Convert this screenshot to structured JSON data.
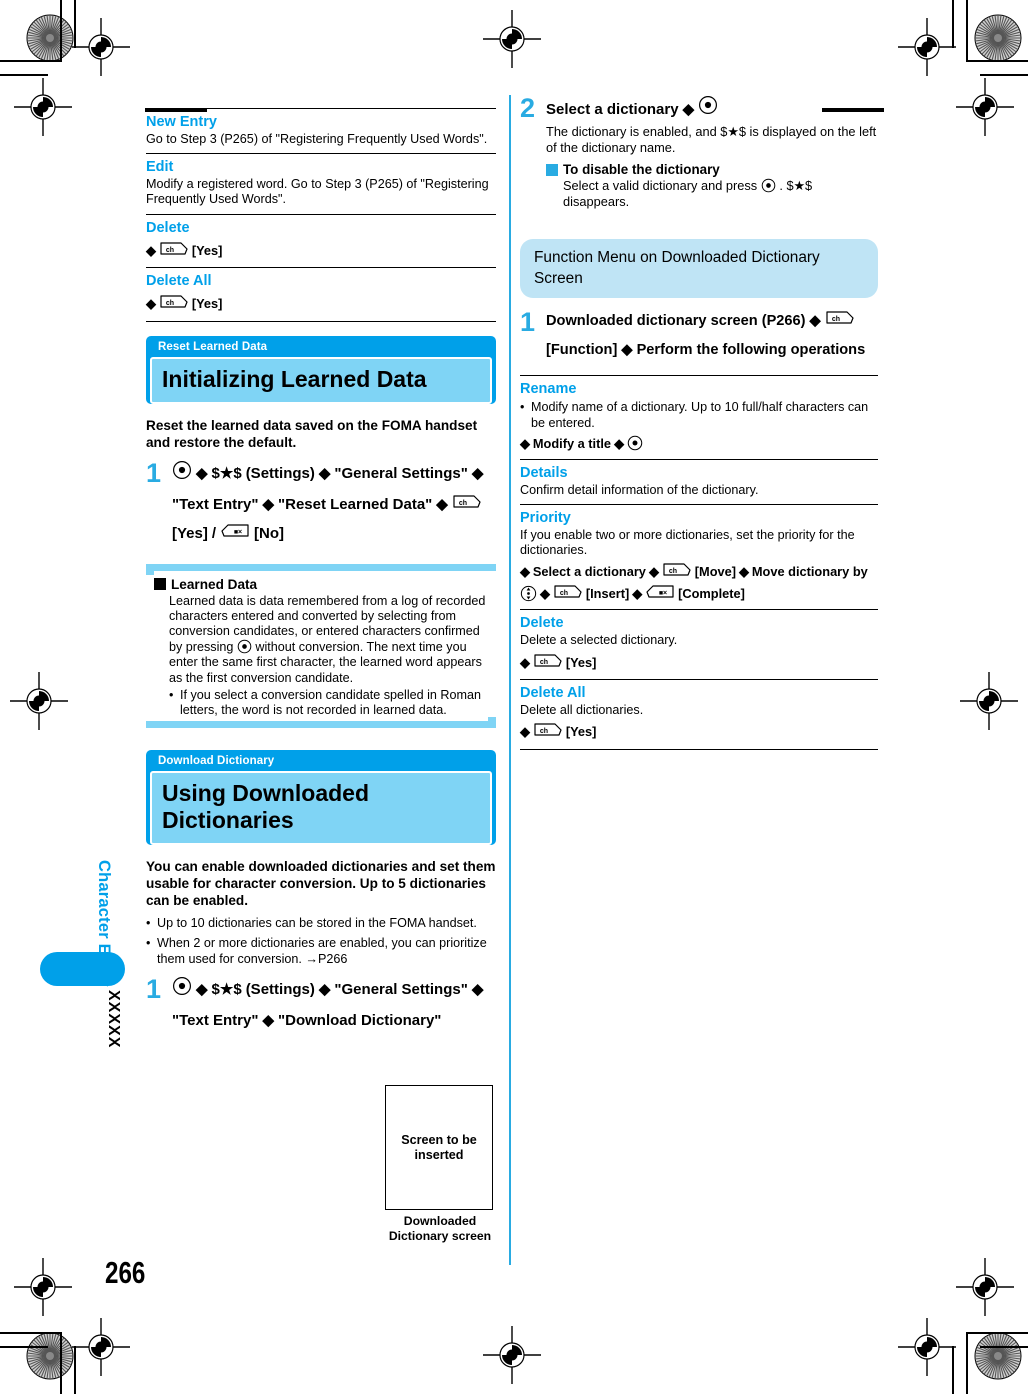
{
  "page": {
    "number": "266",
    "margin_label": "Character Entry",
    "margin_code": "XXXXX"
  },
  "icons": {
    "enter_key": "center-select-key-icon",
    "ch_key": "ch-function-key-icon",
    "clear_key": "clear-key-icon",
    "dpad_key": "dpad-updown-key-icon"
  },
  "left_column": {
    "entries": [
      {
        "title": "New Entry",
        "desc": "Go to Step 3 (P265) of \"Registering Frequently Used Words\"."
      },
      {
        "title": "Edit",
        "desc": "Modify a registered word. Go to Step 3 (P265) of \"Registering Frequently Used Words\"."
      },
      {
        "title": "Delete",
        "op_label": "[Yes]"
      },
      {
        "title": "Delete All",
        "op_label": "[Yes]"
      }
    ],
    "section_reset": {
      "kicker": "Reset Learned Data",
      "title": "Initializing Learned Data",
      "intro": "Reset the learned data saved on the FOMA handset and restore the default.",
      "step": {
        "number": "1",
        "p1": "(Settings)",
        "p2": "\"General Settings\"",
        "p3": "\"Text Entry\"",
        "p4": "\"Reset Learned Data\"",
        "yes": "[Yes]",
        "slash": "/",
        "no": "[No]",
        "star": "$★$"
      }
    },
    "note_learned": {
      "title": "Learned Data",
      "body_a": "Learned data is data remembered from a log of recorded characters entered and converted by selecting from conversion candidates, or entered characters confirmed by pressing",
      "body_b": "without conversion. The next time you enter the same first character, the learned word appears as the first conversion candidate.",
      "bullet": "If you select a conversion candidate spelled in Roman letters, the word is not recorded in learned data."
    },
    "section_download": {
      "kicker": "Download Dictionary",
      "title": "Using Downloaded Dictionaries",
      "intro": "You can enable downloaded dictionaries and set them usable for character conversion. Up to 5 dictionaries can be enabled.",
      "bullets": [
        "Up to 10 dictionaries can be stored in the FOMA handset.",
        "When 2 or more dictionaries are enabled, you can prioritize them used for conversion. →P266"
      ],
      "step": {
        "number": "1",
        "p1": "(Settings)",
        "p2": "\"General Settings\"",
        "p3": "\"Text Entry\"",
        "p4": "\"Download Dictionary\"",
        "star": "$★$"
      }
    },
    "screenshot": {
      "placeholder": "Screen to be inserted",
      "caption": "Downloaded Dictionary screen"
    }
  },
  "right_column": {
    "step2": {
      "number": "2",
      "head": "Select a dictionary",
      "body": "The dictionary is enabled, and $★$ is displayed on the left of the dictionary name.",
      "sub_title": "To disable the dictionary",
      "sub_body_a": "Select a valid dictionary and press",
      "sub_body_b": ". $★$ disappears."
    },
    "callout": "Function Menu on Downloaded Dictionary Screen",
    "step1": {
      "number": "1",
      "p1": "Downloaded dictionary screen (P266)",
      "p2": "[Function]",
      "p3": "Perform the following operations"
    },
    "entries": [
      {
        "title": "Rename",
        "bullet": "Modify name of a dictionary. Up to 10 full/half characters can be entered.",
        "op_text": "Modify a title"
      },
      {
        "title": "Details",
        "desc": "Confirm detail information of the dictionary."
      },
      {
        "title": "Priority",
        "desc": "If you enable two or more dictionaries, set the priority for the dictionaries.",
        "op_a": "Select a dictionary",
        "op_move": "[Move]",
        "op_b": "Move dictionary by",
        "op_insert": "[Insert]",
        "op_complete": "[Complete]"
      },
      {
        "title": "Delete",
        "desc": "Delete a selected dictionary.",
        "op_label": "[Yes]"
      },
      {
        "title": "Delete All",
        "desc": "Delete all dictionaries.",
        "op_label": "[Yes]"
      }
    ]
  },
  "colors": {
    "accent_blue": "#00a0e9",
    "light_blue": "#7fd4f5",
    "callout_blue": "#bfe4f5",
    "step_blue": "#29abe2"
  }
}
